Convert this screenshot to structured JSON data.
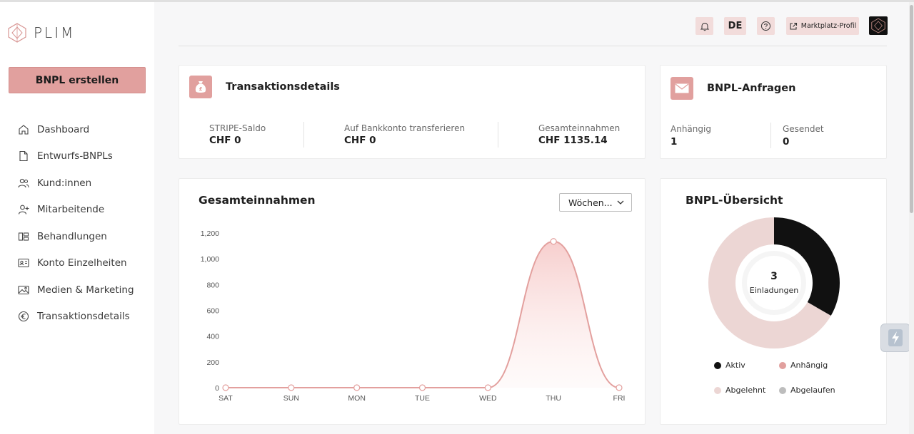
{
  "brand": {
    "name": "PLIM"
  },
  "sidebar": {
    "create_button": "BNPL erstellen",
    "items": [
      {
        "label": "Dashboard",
        "icon": "home-icon"
      },
      {
        "label": "Entwurfs-BNPLs",
        "icon": "file-icon"
      },
      {
        "label": "Kund:innen",
        "icon": "users-icon"
      },
      {
        "label": "Mitarbeitende",
        "icon": "user-plus-icon"
      },
      {
        "label": "Behandlungen",
        "icon": "treatment-icon"
      },
      {
        "label": "Konto Einzelheiten",
        "icon": "id-card-icon"
      },
      {
        "label": "Medien & Marketing",
        "icon": "image-icon"
      },
      {
        "label": "Transaktionsdetails",
        "icon": "euro-icon"
      }
    ]
  },
  "header": {
    "language": "DE",
    "marketplace": "Marktplatz-Profil"
  },
  "transactions": {
    "title": "Transaktionsdetails",
    "stats": [
      {
        "label": "STRIPE-Saldo",
        "value": "CHF 0"
      },
      {
        "label": "Auf Bankkonto transferieren",
        "value": "CHF 0"
      },
      {
        "label": "Gesamteinnahmen",
        "value": "CHF 1135.14"
      }
    ]
  },
  "requests": {
    "title": "BNPL-Anfragen",
    "stats": [
      {
        "label": "Anhängig",
        "value": "1"
      },
      {
        "label": "Gesendet",
        "value": "0"
      }
    ]
  },
  "revenue_chart": {
    "title": "Gesamteinnahmen",
    "period": "Wöchen..."
  },
  "overview": {
    "title": "BNPL-Übersicht",
    "center_value": "3",
    "center_label": "Einladungen",
    "legend": [
      {
        "label": "Aktiv",
        "color": "#111111"
      },
      {
        "label": "Anhängig",
        "color": "#e1a09e"
      },
      {
        "label": "Abgelehnt",
        "color": "#ecd6d4"
      },
      {
        "label": "Abgelaufen",
        "color": "#bdbdbd"
      }
    ]
  },
  "colors": {
    "accent": "#e1a09e",
    "accent_light": "#f2dcdb",
    "line": "#e3a09e"
  },
  "chart_data": [
    {
      "type": "area",
      "title": "Gesamteinnahmen",
      "categories": [
        "SAT",
        "SUN",
        "MON",
        "TUE",
        "WED",
        "THU",
        "FRI"
      ],
      "values": [
        0,
        0,
        0,
        0,
        0,
        1135.14,
        0
      ],
      "y_ticks": [
        "0",
        "200",
        "400",
        "600",
        "800",
        "1,000",
        "1,200"
      ],
      "ylim": [
        0,
        1200
      ],
      "grid": false
    },
    {
      "type": "pie",
      "title": "BNPL-Übersicht",
      "categories": [
        "Aktiv",
        "Anhängig",
        "Abgelehnt",
        "Abgelaufen"
      ],
      "values": [
        1,
        0,
        2,
        0
      ],
      "colors": [
        "#111111",
        "#e1a09e",
        "#ecd6d4",
        "#bdbdbd"
      ]
    }
  ]
}
